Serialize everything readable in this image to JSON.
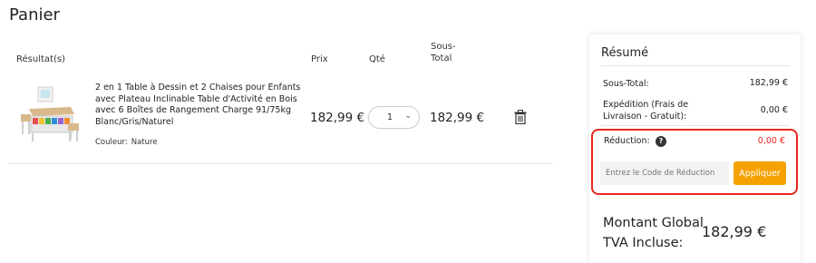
{
  "page": {
    "title": "Panier"
  },
  "cart": {
    "headers": {
      "result": "Résultat(s)",
      "price": "Prix",
      "qty": "Qté",
      "subtotal_line1": "Sous-",
      "subtotal_line2": "Total"
    },
    "item": {
      "name": "2 en 1 Table à Dessin et 2 Chaises pour Enfants avec Plateau Inclinable Table d'Activité en Bois avec 6 Boîtes de Rangement Charge 91/75kg Blanc/Gris/Naturel",
      "color_label": "Couleur:",
      "color_value": "Nature",
      "price": "182,99 €",
      "quantity": "1",
      "subtotal": "182,99 €"
    }
  },
  "summary": {
    "title": "Résumé",
    "subtotal_label": "Sous-Total:",
    "subtotal_value": "182,99 €",
    "shipping_label": "Expédition (Frais de Livraison - Gratuit):",
    "shipping_value": "0,00 €",
    "discount_label": "Réduction:",
    "discount_value": "0,00 €",
    "discount_input_placeholder": "Entrez le Code de Réduction",
    "apply_label": "Appliquer",
    "total_label_line1": "Montant Global",
    "total_label_line2": "TVA Incluse:",
    "total_value": "182,99 €"
  },
  "colors": {
    "accent": "#f5a100",
    "highlight": "#e8271f"
  }
}
